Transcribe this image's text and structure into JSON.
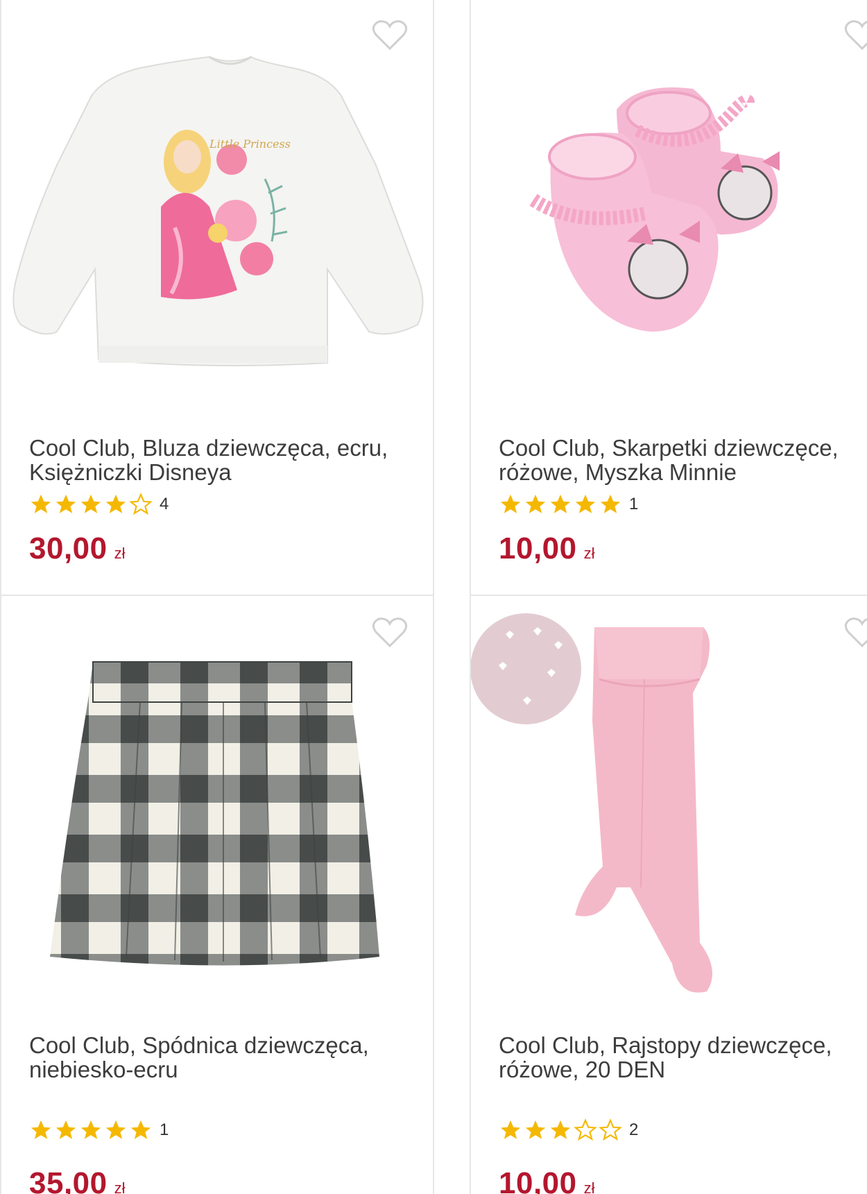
{
  "products": [
    {
      "title": "Cool Club, Bluza dziewczęca, ecru, Księżniczki Disneya",
      "rating": 4,
      "rating_count": "4",
      "price": "30,00",
      "currency": "zł",
      "favorite_icon": "heart-outline-icon"
    },
    {
      "title": "Cool Club, Skarpetki dziewczęce, różowe, Myszka Minnie",
      "rating": 5,
      "rating_count": "1",
      "price": "10,00",
      "currency": "zł",
      "favorite_icon": "heart-outline-icon"
    },
    {
      "title": "Cool Club, Spódnica dziewczęca, niebiesko-ecru",
      "rating": 5,
      "rating_count": "1",
      "price": "35,00",
      "currency": "zł",
      "favorite_icon": "heart-outline-icon"
    },
    {
      "title": "Cool Club, Rajstopy dziewczęce, różowe, 20 DEN",
      "rating": 3,
      "rating_count": "2",
      "price": "10,00",
      "currency": "zł",
      "favorite_icon": "heart-outline-icon"
    }
  ],
  "colors": {
    "price": "#b3172e",
    "star_filled": "#f5b800",
    "star_outline": "#f5b800",
    "card_border": "#e6e6e6"
  }
}
